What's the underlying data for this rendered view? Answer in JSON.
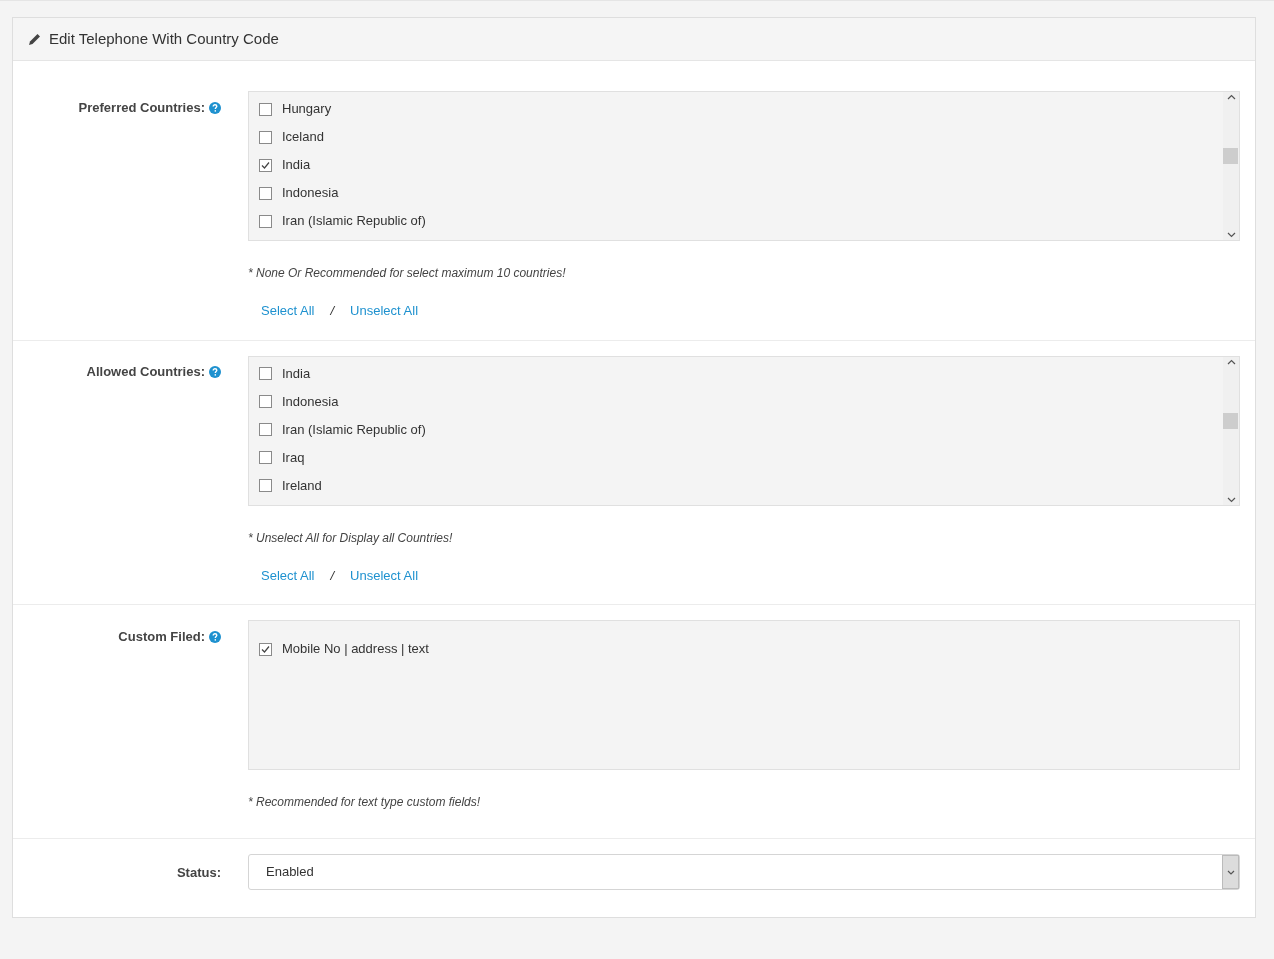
{
  "panel": {
    "title": "Edit Telephone With Country Code"
  },
  "sections": [
    {
      "kind": "checklist",
      "label": "Preferred Countries:",
      "items": [
        {
          "label": "Hungary",
          "checked": false
        },
        {
          "label": "Iceland",
          "checked": false
        },
        {
          "label": "India",
          "checked": true
        },
        {
          "label": "Indonesia",
          "checked": false
        },
        {
          "label": "Iran (Islamic Republic of)",
          "checked": false
        }
      ],
      "note": "* None Or Recommended for select maximum 10 countries!",
      "links": [
        "Select All",
        "Unselect All"
      ],
      "separator": "/"
    },
    {
      "kind": "checklist",
      "label": "Allowed Countries:",
      "items": [
        {
          "label": "India",
          "checked": false
        },
        {
          "label": "Indonesia",
          "checked": false
        },
        {
          "label": "Iran (Islamic Republic of)",
          "checked": false
        },
        {
          "label": "Iraq",
          "checked": false
        },
        {
          "label": "Ireland",
          "checked": false
        }
      ],
      "note": "* Unselect All for Display all Countries!",
      "links": [
        "Select All",
        "Unselect All"
      ],
      "separator": "/"
    },
    {
      "kind": "fields",
      "label": "Custom Filed:",
      "items": [
        {
          "label": "Mobile No | address | text",
          "checked": true
        }
      ],
      "note": "* Recommended for text type custom fields!"
    },
    {
      "kind": "select",
      "label": "Status:",
      "value": "Enabled"
    }
  ]
}
